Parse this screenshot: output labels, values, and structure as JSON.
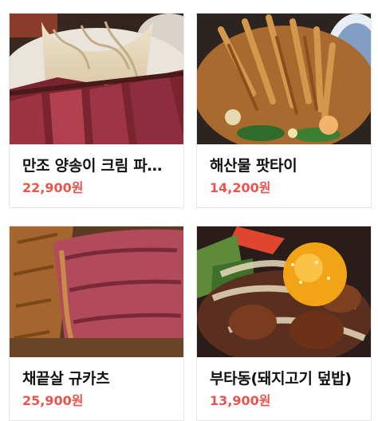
{
  "menu": {
    "items": [
      {
        "name": "만조 양송이 크림 파스타",
        "price": "22,900원",
        "image": "steak-cream-pasta-photo"
      },
      {
        "name": "해산물 팟타이",
        "price": "14,200원",
        "image": "seafood-pad-thai-photo"
      },
      {
        "name": "채끝살 규카츠",
        "price": "25,900원",
        "image": "sirloin-gyukatsu-photo"
      },
      {
        "name": "부타동(돼지고기 덮밥)",
        "price": "13,900원",
        "image": "butadon-egg-yolk-photo"
      }
    ]
  }
}
